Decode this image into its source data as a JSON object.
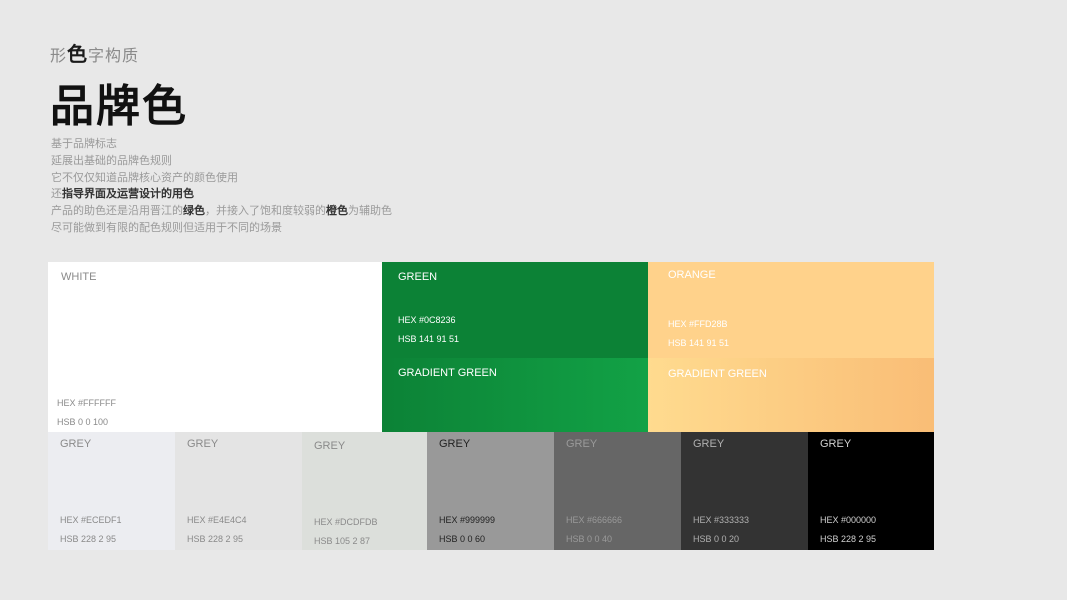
{
  "header": {
    "breadcrumb": [
      "形",
      "色",
      "字构质"
    ],
    "title": "品牌色"
  },
  "intro": {
    "line1": "基于品牌标志",
    "line2": "延展出基础的品牌色规则",
    "line3": "它不仅仅知道品牌核心资产的颜色使用",
    "line4_a": "还",
    "line4_b": "指导界面及运营设计的用色",
    "line5_a": "产品的助色还是沿用晋江的",
    "line5_b": "绿色",
    "line5_c": "，并接入了饱和度较弱的",
    "line5_d": "橙色",
    "line5_e": "为辅助色",
    "line6": "尽可能做到有限的配色规则但适用于不同的场景"
  },
  "colors": {
    "white": {
      "label": "WHITE",
      "hex": "HEX #FFFFFF",
      "hsb": "HSB 0 0 100",
      "color": "#FFFFFF"
    },
    "green": {
      "label": "GREEN",
      "hex": "HEX #0C8236",
      "hsb": "HSB 141 91 51",
      "color": "#0C8236"
    },
    "green_gradient": {
      "label": "GRADIENT GREEN"
    },
    "orange": {
      "label": "ORANGE",
      "hex": "HEX #FFD28B",
      "hsb": "HSB 141 91 51",
      "color": "#FFD28B"
    },
    "orange_gradient": {
      "label": "GRADIENT GREEN"
    },
    "greys": [
      {
        "label": "GREY",
        "hex": "HEX #ECEDF1",
        "hsb": "HSB 228 2 95",
        "color": "#ECEDF1"
      },
      {
        "label": "GREY",
        "hex": "HEX #E4E4C4",
        "hsb": "HSB 228 2 95",
        "color": "#E4E4E4"
      },
      {
        "label": "GREY",
        "hex": "HEX #DCDFDB",
        "hsb": "HSB 105 2 87",
        "color": "#DCDFDB"
      },
      {
        "label": "GREY",
        "hex": "HEX #999999",
        "hsb": "HSB 0 0 60",
        "color": "#999999"
      },
      {
        "label": "GREY",
        "hex": "HEX #666666",
        "hsb": "HSB 0 0 40",
        "color": "#666666"
      },
      {
        "label": "GREY",
        "hex": "HEX #333333",
        "hsb": "HSB 0 0 20",
        "color": "#333333"
      },
      {
        "label": "GREY",
        "hex": "HEX #000000",
        "hsb": "HSB 228 2 95",
        "color": "#000000"
      }
    ]
  }
}
